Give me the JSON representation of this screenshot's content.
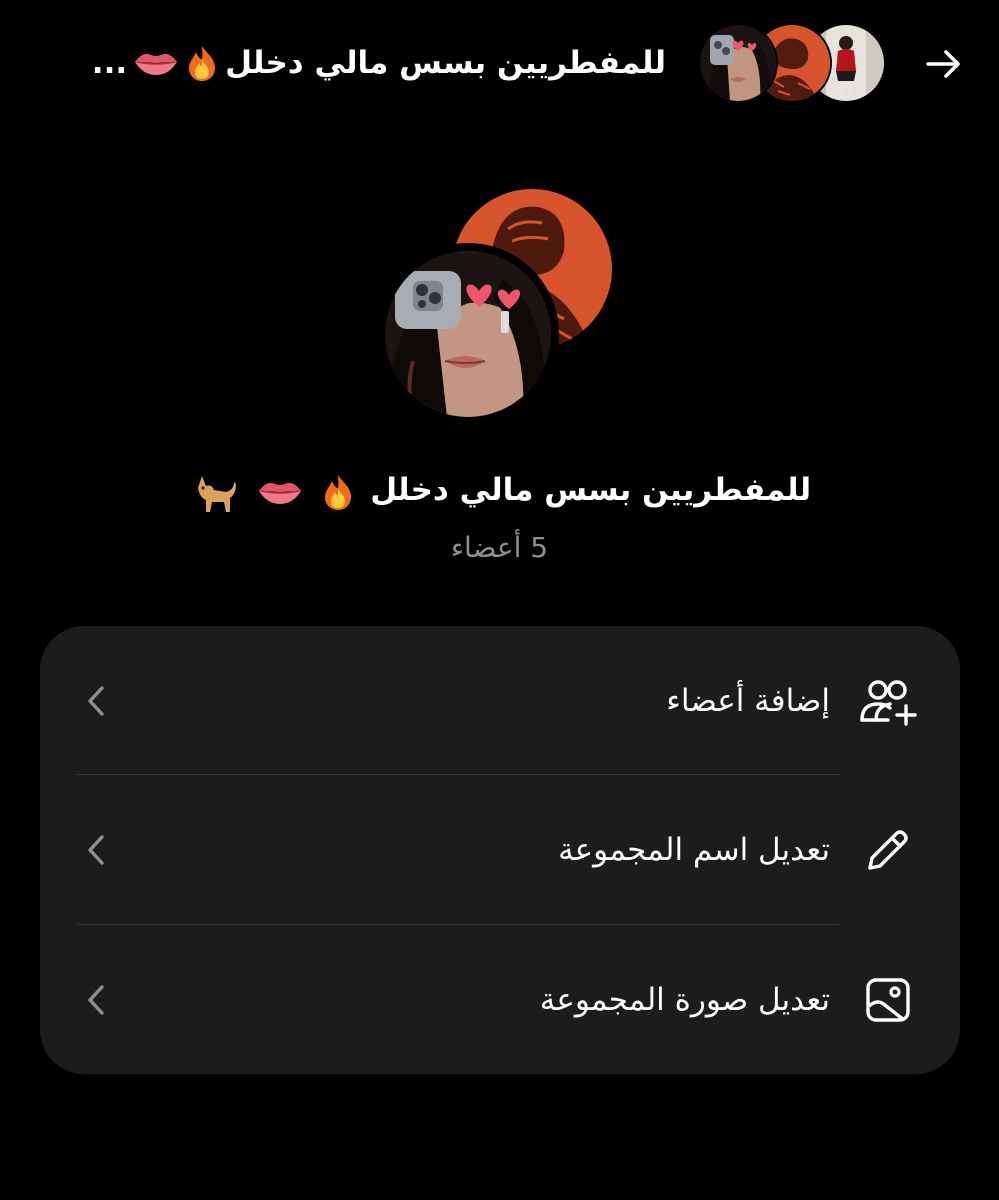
{
  "header": {
    "title": "للمفطريين بسس مالي دخلل",
    "ellipsis": "...",
    "emojis": [
      "fire-emoji",
      "lips-emoji"
    ],
    "avatars": [
      "member-avatar-1",
      "member-avatar-2",
      "member-avatar-3"
    ]
  },
  "group": {
    "name": "للمفطريين بسس مالي دخلل",
    "name_emojis": [
      "fire-emoji",
      "lips-emoji",
      "dog-emoji"
    ],
    "members_count": "5 أعضاء"
  },
  "settings": {
    "rows": [
      {
        "label": "إضافة أعضاء",
        "icon": "add-members-icon"
      },
      {
        "label": "تعديل اسم المجموعة",
        "icon": "pencil-icon"
      },
      {
        "label": "تعديل صورة المجموعة",
        "icon": "image-icon"
      }
    ]
  },
  "colors": {
    "background": "#000000",
    "card": "#1c1c1e",
    "divider": "#38383a",
    "secondary_text": "#8e8e93",
    "chevron": "#8e8e93",
    "avatar_orange": "#d8542c"
  }
}
